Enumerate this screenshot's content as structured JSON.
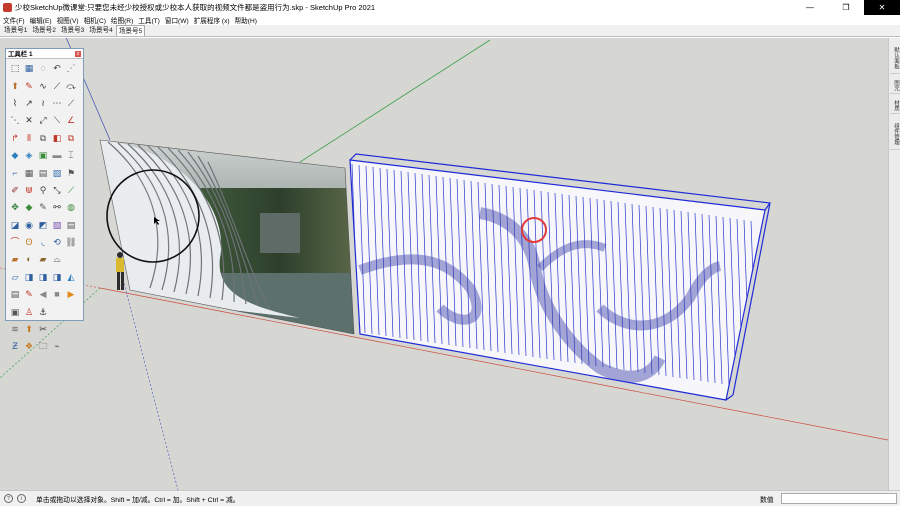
{
  "window": {
    "title": "少校SketchUp微课堂:只要您未经少校授权或少校本人获取的视频文件都是盗用行为.skp - SketchUp Pro 2021",
    "minimize_glyph": "—",
    "maximize_glyph": "❐",
    "close_glyph": "✕"
  },
  "menu": [
    "文件(F)",
    "编辑(E)",
    "视图(V)",
    "相机(C)",
    "绘图(R)",
    "工具(T)",
    "窗口(W)",
    "扩展程序 (x)",
    "帮助(H)"
  ],
  "scene_tabs": [
    "场景号1",
    "场景号2",
    "场景号3",
    "场景号4",
    "场景号5"
  ],
  "active_scene": "场景号5",
  "toolbar": {
    "title": "工具栏 1",
    "close_glyph": "x",
    "tools": [
      {
        "name": "select-icon",
        "glyph": "⬚",
        "color": "#333"
      },
      {
        "name": "component-icon",
        "glyph": "▦",
        "color": "#2e5f9e"
      },
      {
        "name": "lasso-icon",
        "glyph": "◌",
        "color": "#555"
      },
      {
        "name": "arc-select-icon",
        "glyph": "↶",
        "color": "#444"
      },
      {
        "name": "dotted-select-icon",
        "glyph": "⋰",
        "color": "#666"
      },
      {
        "name": "paint-icon",
        "glyph": "⬆",
        "color": "#b8702e"
      },
      {
        "name": "pencil-icon",
        "glyph": "✎",
        "color": "#c0392b"
      },
      {
        "name": "freehand-icon",
        "glyph": "∿",
        "color": "#333"
      },
      {
        "name": "line-icon",
        "glyph": "⟋",
        "color": "#333"
      },
      {
        "name": "curve-icon",
        "glyph": "⤼",
        "color": "#333"
      },
      {
        "name": "polyline-icon",
        "glyph": "⌇",
        "color": "#333"
      },
      {
        "name": "arrow-icon",
        "glyph": "↗",
        "color": "#333"
      },
      {
        "name": "wave-icon",
        "glyph": "≀",
        "color": "#333"
      },
      {
        "name": "dots-icon",
        "glyph": "⋯",
        "color": "#333"
      },
      {
        "name": "diagonal-icon",
        "glyph": "⟋",
        "color": "#444"
      },
      {
        "name": "split-icon",
        "glyph": "⋱",
        "color": "#333"
      },
      {
        "name": "intersect-icon",
        "glyph": "✕",
        "color": "#333"
      },
      {
        "name": "extend-icon",
        "glyph": "⤢",
        "color": "#333"
      },
      {
        "name": "offset-line-icon",
        "glyph": "⟍",
        "color": "#333"
      },
      {
        "name": "angle-icon",
        "glyph": "∠",
        "color": "#c0392b"
      },
      {
        "name": "bend-icon",
        "glyph": "↱",
        "color": "#c0392b"
      },
      {
        "name": "parallel-icon",
        "glyph": "⫴",
        "color": "#c0392b"
      },
      {
        "name": "copy-icon",
        "glyph": "⧉",
        "color": "#555"
      },
      {
        "name": "stack-icon",
        "glyph": "◧",
        "color": "#c0392b"
      },
      {
        "name": "duplicate-icon",
        "glyph": "⧉",
        "color": "#c0392b"
      },
      {
        "name": "push-pull-icon",
        "glyph": "◆",
        "color": "#2e7fbf"
      },
      {
        "name": "follow-icon",
        "glyph": "◈",
        "color": "#2e7fbf"
      },
      {
        "name": "shell-icon",
        "glyph": "▣",
        "color": "#3a8c3a"
      },
      {
        "name": "flatten-icon",
        "glyph": "▬",
        "color": "#888"
      },
      {
        "name": "measure-icon",
        "glyph": "⌶",
        "color": "#666"
      },
      {
        "name": "sweep-icon",
        "glyph": "⌐",
        "color": "#3a6fb0"
      },
      {
        "name": "grid-icon",
        "glyph": "▦",
        "color": "#555"
      },
      {
        "name": "panel-icon",
        "glyph": "▤",
        "color": "#555"
      },
      {
        "name": "box-icon",
        "glyph": "▨",
        "color": "#3a6fb0"
      },
      {
        "name": "flag-icon",
        "glyph": "⚑",
        "color": "#555"
      },
      {
        "name": "brush-icon",
        "glyph": "✐",
        "color": "#8b2a2a"
      },
      {
        "name": "magnet-icon",
        "glyph": "⋓",
        "color": "#c0392b"
      },
      {
        "name": "pin-icon",
        "glyph": "⚲",
        "color": "#444"
      },
      {
        "name": "stretch-icon",
        "glyph": "⤡",
        "color": "#333"
      },
      {
        "name": "knife-icon",
        "glyph": "⟋",
        "color": "#2e8b3a"
      },
      {
        "name": "move-icon",
        "glyph": "✥",
        "color": "#2e7a3a"
      },
      {
        "name": "terrain-icon",
        "glyph": "◆",
        "color": "#3a8c3a"
      },
      {
        "name": "eraser-icon",
        "glyph": "✎",
        "color": "#555"
      },
      {
        "name": "weld-icon",
        "glyph": "⚯",
        "color": "#333"
      },
      {
        "name": "globe-icon",
        "glyph": "◍",
        "color": "#3a8c3a"
      },
      {
        "name": "solid-tools-icon",
        "glyph": "◪",
        "color": "#2e5f9e"
      },
      {
        "name": "hole-icon",
        "glyph": "◉",
        "color": "#2e5f9e"
      },
      {
        "name": "cube-icon",
        "glyph": "◩",
        "color": "#2e5f9e"
      },
      {
        "name": "stripe-icon",
        "glyph": "▧",
        "color": "#7a4fb0"
      },
      {
        "name": "folder-box-icon",
        "glyph": "▤",
        "color": "#555"
      },
      {
        "name": "arc-tool-icon",
        "glyph": "⌒",
        "color": "#c0392b"
      },
      {
        "name": "coil-icon",
        "glyph": "ʘ",
        "color": "#c87a20"
      },
      {
        "name": "fillet-icon",
        "glyph": "◟",
        "color": "#2e5f9e"
      },
      {
        "name": "rotate-icon",
        "glyph": "⟲",
        "color": "#2e5f9e"
      },
      {
        "name": "link-icon",
        "glyph": "⛓",
        "color": "#555"
      },
      {
        "name": "layer-icon",
        "glyph": "▰",
        "color": "#b8702e"
      },
      {
        "name": "roll-icon",
        "glyph": "◐",
        "color": "#8a6a2e"
      },
      {
        "name": "wood-icon",
        "glyph": "▰",
        "color": "#8a6a2e"
      },
      {
        "name": "bridge-icon",
        "glyph": "⌓",
        "color": "#555"
      },
      {
        "name": "empty-slot-icon",
        "glyph": " ",
        "color": "#555"
      },
      {
        "name": "plate-icon",
        "glyph": "▱",
        "color": "#3a6fb0"
      },
      {
        "name": "solid-a-icon",
        "glyph": "◨",
        "color": "#2e5f9e"
      },
      {
        "name": "solid-b-icon",
        "glyph": "◨",
        "color": "#2e5f9e"
      },
      {
        "name": "solid-c-icon",
        "glyph": "◨",
        "color": "#2e5f9e"
      },
      {
        "name": "solid-d-icon",
        "glyph": "◭",
        "color": "#2e7fbf"
      },
      {
        "name": "note-icon",
        "glyph": "▤",
        "color": "#555"
      },
      {
        "name": "pen-bar-icon",
        "glyph": "✎",
        "color": "#c0392b"
      },
      {
        "name": "prev-icon",
        "glyph": "◀",
        "color": "#888"
      },
      {
        "name": "stop-icon",
        "glyph": "■",
        "color": "#888"
      },
      {
        "name": "play-icon",
        "glyph": "▶",
        "color": "#e28a1c"
      },
      {
        "name": "camera-icon",
        "glyph": "▣",
        "color": "#555"
      },
      {
        "name": "figure-icon",
        "glyph": "♙",
        "color": "#c0392b"
      },
      {
        "name": "anchor-icon",
        "glyph": "⚓",
        "color": "#333"
      },
      {
        "name": "empty-slot-2-icon",
        "glyph": " ",
        "color": "#555"
      },
      {
        "name": "empty-slot-3-icon",
        "glyph": " ",
        "color": "#555"
      },
      {
        "name": "wireless-icon",
        "glyph": "≋",
        "color": "#666"
      },
      {
        "name": "marker-icon",
        "glyph": "⬆",
        "color": "#c87a20"
      },
      {
        "name": "scissors-icon",
        "glyph": "✂",
        "color": "#333"
      },
      {
        "name": "empty-slot-4-icon",
        "glyph": " ",
        "color": "#555"
      },
      {
        "name": "empty-slot-5-icon",
        "glyph": " ",
        "color": "#555"
      },
      {
        "name": "z-axis-icon",
        "glyph": "Ƶ",
        "color": "#2e5f9e"
      },
      {
        "name": "material-icon",
        "glyph": "❖",
        "color": "#c87a20"
      },
      {
        "name": "folder-icon",
        "glyph": "🗀",
        "color": "#555"
      },
      {
        "name": "tag-icon",
        "glyph": "⌁",
        "color": "#666"
      },
      {
        "name": "empty-slot-6-icon",
        "glyph": " ",
        "color": "#555"
      }
    ]
  },
  "right_tabs": [
    "默认面板",
    "图元",
    "材质",
    "组件管理"
  ],
  "status": {
    "message": "单击或拖动以选择对象。Shift = 加/减。Ctrl = 加。Shift + Ctrl = 减。",
    "vcb_label": "数值",
    "vcb_value": "",
    "help_glyph": "?",
    "info_glyph": "i"
  },
  "colors": {
    "viewport_bg": "#d6d6d3",
    "selection_blue": "#1f2bd8",
    "axis_red": "#cc4a3a",
    "axis_green": "#3fa24a",
    "axis_blue": "#3a4fb8"
  }
}
